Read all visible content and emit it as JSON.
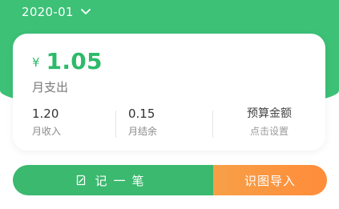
{
  "header": {
    "month": "2020-01",
    "dropdown_icon": "chevron-down-icon"
  },
  "summary": {
    "currency": "¥",
    "amount": "1.05",
    "amount_label": "月支出"
  },
  "stats": {
    "income_value": "1.20",
    "income_label": "月收入",
    "balance_value": "0.15",
    "balance_label": "月结余",
    "budget_title": "预算金额",
    "budget_action": "点击设置"
  },
  "actions": {
    "record_icon": "edit-note-icon",
    "record_label": "记一笔",
    "import_label": "识图导入"
  },
  "colors": {
    "primary_green": "#3cc176",
    "amount_green": "#2dba6a",
    "import_orange": "#ff8c3a"
  }
}
